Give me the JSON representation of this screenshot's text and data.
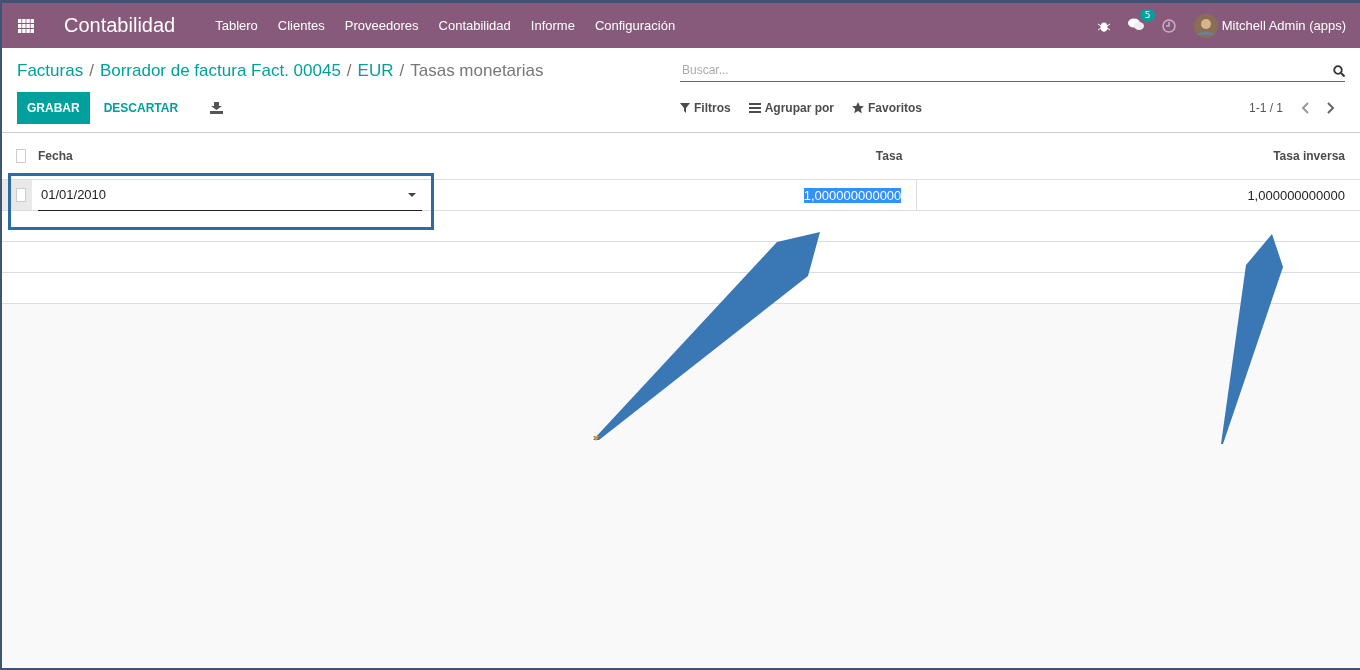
{
  "topbar": {
    "app_name": "Contabilidad",
    "menu": [
      "Tablero",
      "Clientes",
      "Proveedores",
      "Contabilidad",
      "Informe",
      "Configuración"
    ],
    "messages_badge": "5",
    "user": "Mitchell Admin (apps)"
  },
  "breadcrumbs": [
    {
      "label": "Facturas",
      "current": false
    },
    {
      "separator": "/",
      "label": "Borrador de factura Fact. 00045",
      "current": false
    },
    {
      "separator": "/",
      "label": "EUR",
      "current": false
    },
    {
      "separator": "/",
      "label": "Tasas monetarias",
      "current": true
    }
  ],
  "buttons": [
    {
      "label": "GRABAR",
      "primary": true
    },
    {
      "label": "DESCARTAR",
      "primary": false
    }
  ],
  "search": {
    "placeholder": "Buscar..."
  },
  "filters": [
    {
      "label": "Filtros",
      "kind": "filter"
    },
    {
      "label": "Agrupar por",
      "kind": "group"
    },
    {
      "label": "Favoritos",
      "kind": "favorite"
    }
  ],
  "pager": "1-1 / 1",
  "table": {
    "select_all_checked": false,
    "columns": [
      "Fecha",
      "Tasa",
      "Tasa inversa"
    ],
    "rows": [
      {
        "checked": false,
        "editing": true,
        "cells": [
          {
            "text": "01/01/2010",
            "selected": false
          },
          {
            "text": "1,000000000000",
            "selected": true
          },
          {
            "text": "1,000000000000",
            "selected": false
          }
        ]
      }
    ]
  }
}
